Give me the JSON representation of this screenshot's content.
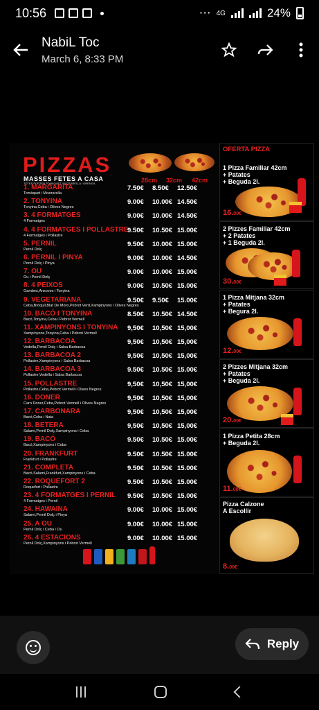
{
  "status": {
    "time": "10:56",
    "network": "4G",
    "battery": "24%"
  },
  "header": {
    "sender": "NabiL Toc",
    "date": "March 6, 8:33 PM"
  },
  "flyer": {
    "title": "PIZZAS",
    "subtitle": "MASSES FETES A CASA",
    "subnote": "TOTES PORTEN TOMÀQUET, MOZZARELLA I ORENGA",
    "sizes": [
      "28cm",
      "32cm",
      "42cm"
    ],
    "items": [
      {
        "name": "1. MARGARITA",
        "desc": "Tomàquet i Mozzarella",
        "p1": "7.50€",
        "p2": "8.50€",
        "p3": "12.50€"
      },
      {
        "name": "2. TONYINA",
        "desc": "Tonyina,Ceba i Olives Negres",
        "p1": "9.00€",
        "p2": "10.00€",
        "p3": "14.50€"
      },
      {
        "name": "3. 4 FORMATGES",
        "desc": "4 Formatges",
        "p1": "9.00€",
        "p2": "10.00€",
        "p3": "14.50€"
      },
      {
        "name": "4. 4 FORMATGES I POLLASTRE",
        "desc": "4 Formatges i Pollastre",
        "p1": "9.50€",
        "p2": "10.50€",
        "p3": "15.00€"
      },
      {
        "name": "5. PERNIL",
        "desc": "Pernil Dolç",
        "p1": "9.50€",
        "p2": "10.00€",
        "p3": "15.00€"
      },
      {
        "name": "6. PERNIL I PINYA",
        "desc": "Pernil Dolç i Pinya",
        "p1": "9.00€",
        "p2": "10.00€",
        "p3": "14.50€"
      },
      {
        "name": "7. OU",
        "desc": "Ou i Pernil Dolç",
        "p1": "9.00€",
        "p2": "10.00€",
        "p3": "15.00€"
      },
      {
        "name": "8. 4 PEIXOS",
        "desc": "Gambes,Anxoves i Tonyina",
        "p1": "9.00€",
        "p2": "10.50€",
        "p3": "15.00€"
      },
      {
        "name": "9. VEGETARIANA",
        "desc": "Ceba,Bròquil,Blat De Moro,Pebrot Verd,Xampinyons i Olives Negres",
        "p1": "9.50€",
        "p2": "9.50€",
        "p3": "15.00€"
      },
      {
        "name": "10. BACÓ I TONYINA",
        "desc": "Bacó,Tonyina,Ceba i Pebrot Vermell",
        "p1": "8.50€",
        "p2": "10.50€",
        "p3": "14.50€"
      },
      {
        "name": "11. XAMPINYONS I TONYINA",
        "desc": "Xampinyons,Tonyina,Ceba i Pebrot Vermell",
        "p1": "9,50€",
        "p2": "10,50€",
        "p3": "15,00€"
      },
      {
        "name": "12. BARBACOA",
        "desc": "Vedella,Pernil Dolç i Salsa Barbacoa",
        "p1": "9,50€",
        "p2": "10,50€",
        "p3": "15,00€"
      },
      {
        "name": "13. BARBACOA 2",
        "desc": "Pollastre,Xampinyons i Salsa Barbacoa",
        "p1": "9,50€",
        "p2": "10,50€",
        "p3": "15,00€"
      },
      {
        "name": "14. BARBACOA 3",
        "desc": "Pollastre,Vedella i Salsa Barbacoa",
        "p1": "9.50€",
        "p2": "10.50€",
        "p3": "15.00€"
      },
      {
        "name": "15. POLLASTRE",
        "desc": "Pollastre,Ceba,Pebrot Vermell i Olives Negres",
        "p1": "9,50€",
        "p2": "10,50€",
        "p3": "15,00€"
      },
      {
        "name": "16. DONER",
        "desc": "Carn Doner,Ceba,Pebrot Vermell i Olives Negres",
        "p1": "9,50€",
        "p2": "10,50€",
        "p3": "15,00€"
      },
      {
        "name": "17. CARBONARA",
        "desc": "Bacó,Ceba i Nata",
        "p1": "9,50€",
        "p2": "10,50€",
        "p3": "15,00€"
      },
      {
        "name": "18. BETERA",
        "desc": "Salami,Pernil Dolç,Xampinyons i Ceba",
        "p1": "9,50€",
        "p2": "10,50€",
        "p3": "15,00€"
      },
      {
        "name": "19. BACÓ",
        "desc": "Bacó,Xampinyons i Ceba",
        "p1": "9.50€",
        "p2": "10.50€",
        "p3": "15.00€"
      },
      {
        "name": "20. FRANKFURT",
        "desc": "Frankfurt i Pollastre",
        "p1": "9.50€",
        "p2": "10.50€",
        "p3": "15.00€"
      },
      {
        "name": "21. COMPLETA",
        "desc": "Bacó,Salami,Frankfurt,Xampinyons i Ceba",
        "p1": "9.50€",
        "p2": "10.50€",
        "p3": "15.00€"
      },
      {
        "name": "22. ROQUEFORT 2",
        "desc": "Roquefort i Pollastre",
        "p1": "9.50€",
        "p2": "10.50€",
        "p3": "15.00€"
      },
      {
        "name": "23. 4 FORMATGES I PERNIL",
        "desc": "4 Formatges i Pernil",
        "p1": "9.50€",
        "p2": "10.50€",
        "p3": "15.00€"
      },
      {
        "name": "24. HAWAINA",
        "desc": "Salami,Pernil Dolç i Pinya",
        "p1": "9.00€",
        "p2": "10.00€",
        "p3": "15.00€"
      },
      {
        "name": "25. A OU",
        "desc": "Pernil Dolç i Ceba i Ou",
        "p1": "9.00€",
        "p2": "10.00€",
        "p3": "15.00€"
      },
      {
        "name": "26. 4 ESTACIONS",
        "desc": "Pernil Dolç,Xampinyons i Pebrot Vermell",
        "p1": "9.00€",
        "p2": "10.00€",
        "p3": "15.00€"
      }
    ],
    "offers": [
      {
        "title": "OFERTA PIZZA",
        "text": "1 Pizza Familiar 42cm\n+ Patates\n+ Beguda 2l.",
        "price": "16.",
        "cents": "00€"
      },
      {
        "title": "",
        "text": "2 Pizzes Familiar 42cm\n+ 2 Patates\n+ 1 Beguda 2l.",
        "price": "30.",
        "cents": "00€"
      },
      {
        "title": "",
        "text": "1 Pizza Mitjana 32cm\n+ Patates\n+ Begura 2l.",
        "price": "12.",
        "cents": "00€"
      },
      {
        "title": "",
        "text": "2 Pizzes Mitjana 32cm\n+ Patates\n+ Beguda 2l.",
        "price": "20.",
        "cents": "00€"
      },
      {
        "title": "",
        "text": "1 Pizza Petita 28cm\n+ Beguda 2l.",
        "price": "11.",
        "cents": "00€"
      },
      {
        "title": "",
        "text": "Pizza Calzone\nA Escollir",
        "price": "8.",
        "cents": "00€"
      }
    ]
  },
  "reply": {
    "label": "Reply"
  },
  "colors": {
    "accent_red": "#e52222",
    "background": "#000000",
    "button_bg": "#2a2a2a"
  }
}
